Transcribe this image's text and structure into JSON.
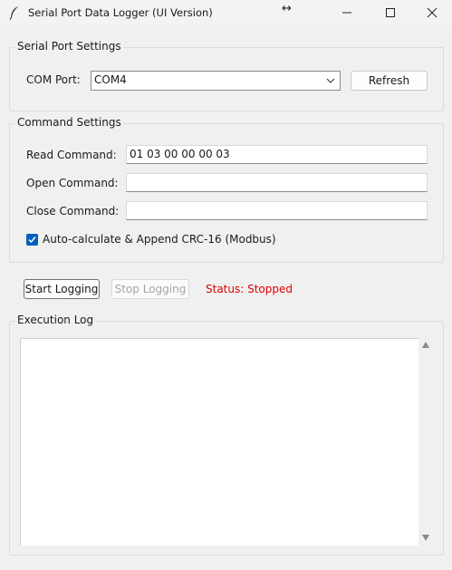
{
  "window": {
    "title": "Serial Port Data Logger (UI Version)",
    "resize_glyph": "↔",
    "icons": [
      "feather-icon",
      "minimize-icon",
      "maximize-icon",
      "close-icon"
    ]
  },
  "serial_settings": {
    "group_title": "Serial Port Settings",
    "com_port_label": "COM Port:",
    "com_port_value": "COM4",
    "refresh_label": "Refresh"
  },
  "command_settings": {
    "group_title": "Command Settings",
    "read_label": "Read Command:",
    "read_value": "01 03 00 00 00 03",
    "open_label": "Open Command:",
    "open_value": "",
    "close_label": "Close Command:",
    "close_value": "",
    "crc_label": "Auto-calculate & Append CRC-16 (Modbus)",
    "crc_checked": true
  },
  "controls": {
    "start_label": "Start Logging",
    "stop_label": "Stop Logging",
    "status_text": "Status: Stopped",
    "status_color": "#e00000"
  },
  "log": {
    "group_title": "Execution Log",
    "content": ""
  },
  "colors": {
    "accent": "#005fb8",
    "background": "#f0f0f0"
  }
}
